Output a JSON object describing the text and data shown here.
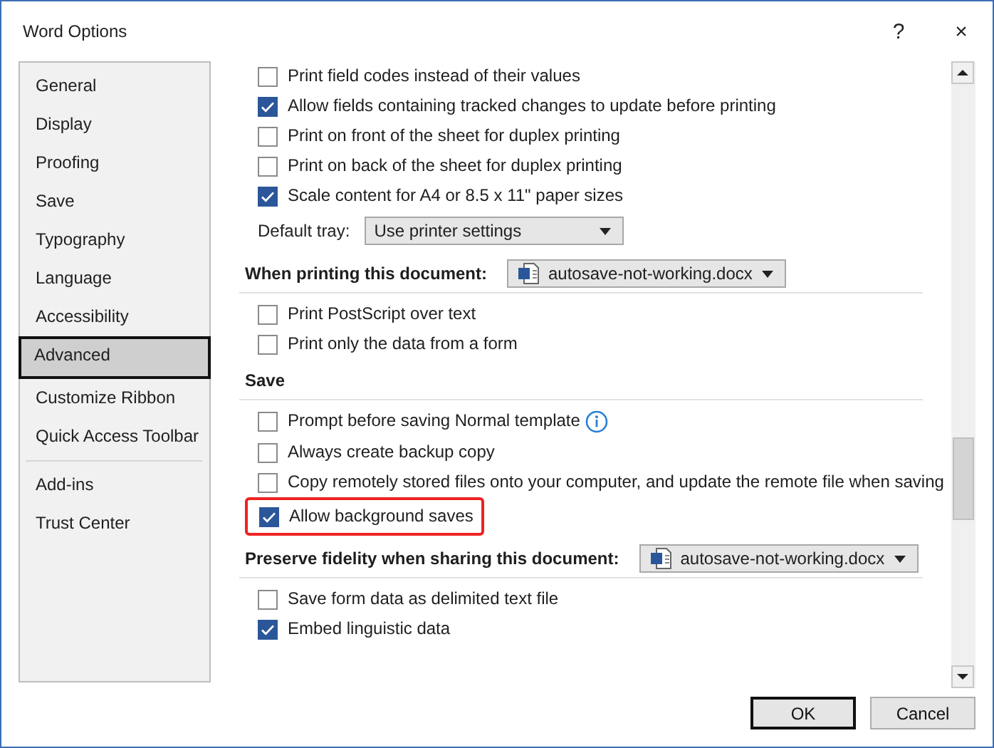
{
  "window": {
    "title": "Word Options",
    "help": "?",
    "close": "×"
  },
  "sidebar": {
    "groups": [
      [
        {
          "label": "General",
          "selected": false
        },
        {
          "label": "Display",
          "selected": false
        },
        {
          "label": "Proofing",
          "selected": false
        },
        {
          "label": "Save",
          "selected": false
        },
        {
          "label": "Typography",
          "selected": false
        },
        {
          "label": "Language",
          "selected": false
        },
        {
          "label": "Accessibility",
          "selected": false
        },
        {
          "label": "Advanced",
          "selected": true
        },
        {
          "label": "Customize Ribbon",
          "selected": false
        },
        {
          "label": "Quick Access Toolbar",
          "selected": false
        }
      ],
      [
        {
          "label": "Add-ins",
          "selected": false
        },
        {
          "label": "Trust Center",
          "selected": false
        }
      ]
    ]
  },
  "content": [
    {
      "kind": "checkbox",
      "label": "Print field codes instead of their values",
      "checked": false
    },
    {
      "kind": "checkbox",
      "label": "Allow fields containing tracked changes to update before printing",
      "checked": true
    },
    {
      "kind": "checkbox",
      "label": "Print on front of the sheet for duplex printing",
      "checked": false
    },
    {
      "kind": "checkbox",
      "label": "Print on back of the sheet for duplex printing",
      "checked": false
    },
    {
      "kind": "checkbox",
      "label": "Scale content for A4 or 8.5 x 11\" paper sizes",
      "checked": true
    },
    {
      "kind": "dropdown",
      "label": "Default tray:",
      "value": "Use printer settings"
    },
    {
      "kind": "section",
      "label": "When printing this document:",
      "value": "autosave-not-working.docx"
    },
    {
      "kind": "checkbox",
      "label": "Print PostScript over text",
      "checked": false
    },
    {
      "kind": "checkbox",
      "label": "Print only the data from a form",
      "checked": false
    },
    {
      "kind": "heading",
      "label": "Save"
    },
    {
      "kind": "checkbox",
      "label": "Prompt before saving Normal template",
      "checked": false,
      "info": true
    },
    {
      "kind": "checkbox",
      "label": "Always create backup copy",
      "checked": false
    },
    {
      "kind": "checkbox",
      "label": "Copy remotely stored files onto your computer, and update the remote file when saving",
      "checked": false
    },
    {
      "kind": "checkbox",
      "label": "Allow background saves",
      "checked": true,
      "highlighted": true
    },
    {
      "kind": "section",
      "label": "Preserve fidelity when sharing this document:",
      "value": "autosave-not-working.docx"
    },
    {
      "kind": "checkbox",
      "label": "Save form data as delimited text file",
      "checked": false
    },
    {
      "kind": "checkbox",
      "label": "Embed linguistic data",
      "checked": true
    }
  ],
  "buttons": [
    {
      "label": "OK",
      "default": true
    },
    {
      "label": "Cancel",
      "default": false
    }
  ]
}
